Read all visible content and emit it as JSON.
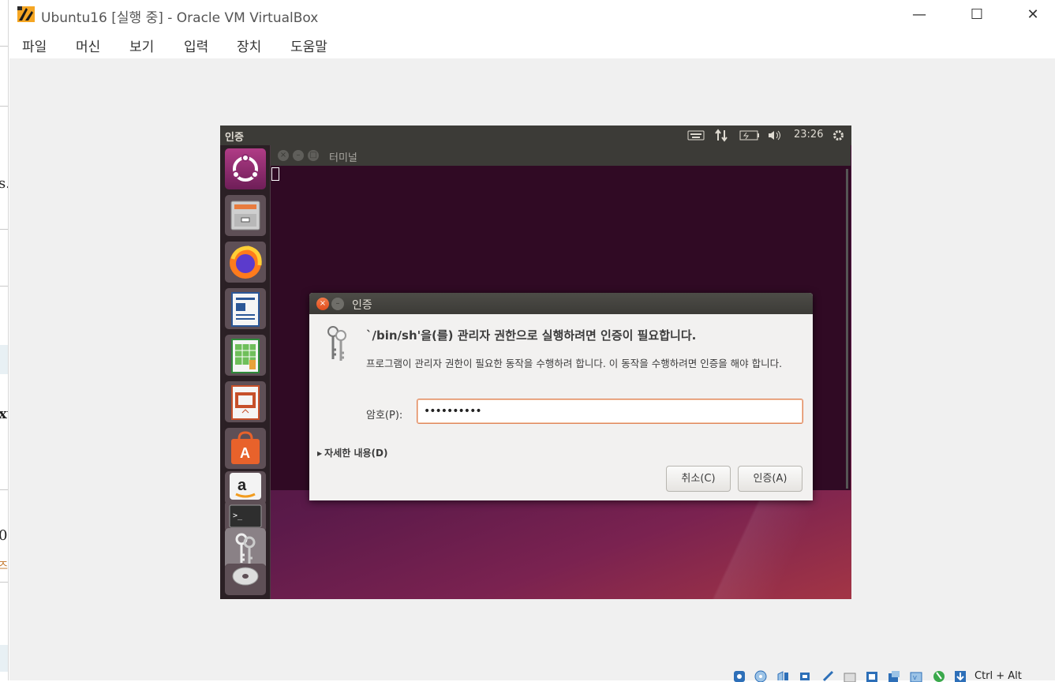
{
  "window": {
    "title": "Ubuntu16 [실행 중] - Oracle VM VirtualBox",
    "minimize_glyph": "—",
    "maximize_glyph": "☐",
    "close_glyph": "✕"
  },
  "menu": [
    "파일",
    "머신",
    "보기",
    "입력",
    "장치",
    "도움말"
  ],
  "behind_fragments": [
    "s.",
    "xt",
    "0",
    "즈"
  ],
  "guest": {
    "panel": {
      "title": "인증",
      "time": "23:26",
      "icons": [
        "keyboard-icon",
        "network-icon",
        "battery-icon",
        "volume-icon",
        "gear-icon"
      ]
    },
    "launcher": [
      "ubuntu-dash-icon",
      "files-icon",
      "firefox-icon",
      "writer-icon",
      "calc-icon",
      "impress-icon",
      "software-center-icon",
      "amazon-icon",
      "terminal-icon",
      "auth-keys-icon",
      "dvd-icon"
    ],
    "terminal": {
      "title": "터미널"
    },
    "dialog": {
      "title": "인증",
      "heading": "`/bin/sh'을(를) 관리자 권한으로 실행하려면 인증이 필요합니다.",
      "description": "프로그램이 관리자 권한이 필요한 동작을 수행하려 합니다. 이 동작을 수행하려면 인증을 해야 합니다.",
      "password_label": "암호(P):",
      "password_value": "••••••••••",
      "details_label": "자세한 내용(D)",
      "cancel_label": "취소(C)",
      "auth_label": "인증(A)"
    }
  },
  "statusbar": {
    "host_key": "Ctrl + Alt"
  }
}
